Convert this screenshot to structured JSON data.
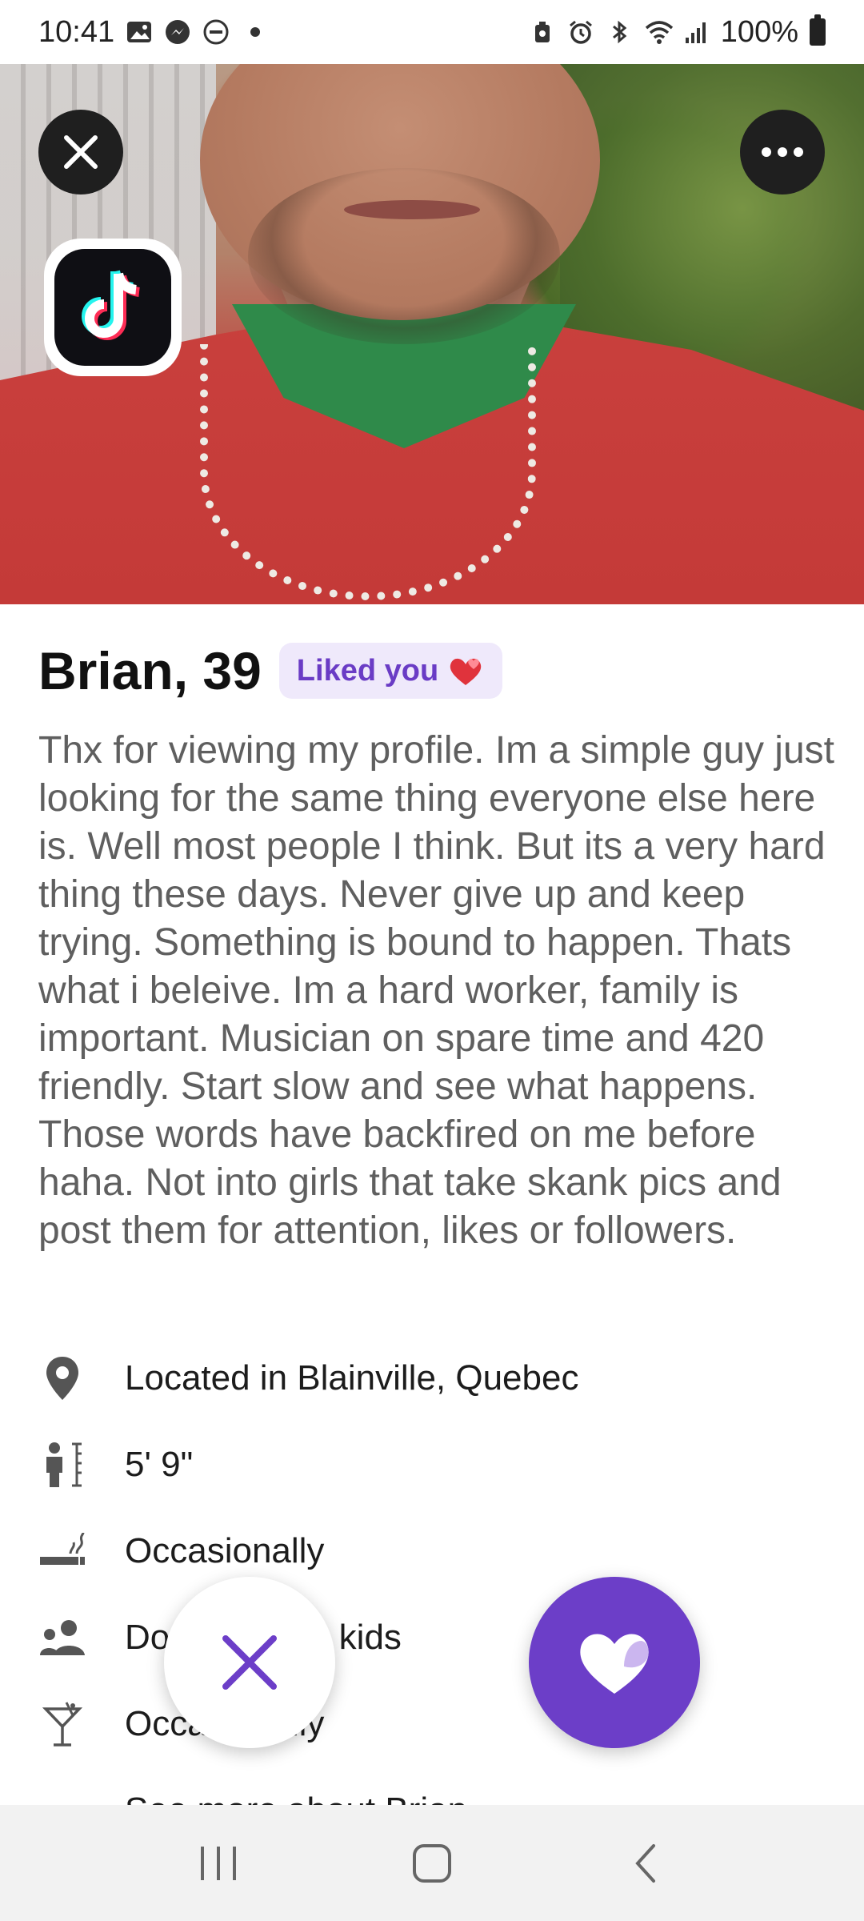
{
  "status_bar": {
    "time": "10:41",
    "battery": "100%"
  },
  "hero": {
    "close_icon": "close-icon",
    "more_icon": "more-horizontal-icon",
    "badge_icon": "tiktok-icon"
  },
  "profile": {
    "name_age": "Brian, 39",
    "liked_badge": "Liked you",
    "bio": "Thx for viewing my profile.  Im a simple guy just looking for the same thing everyone else here is.  Well most people I think.  But its a very hard thing these days.  Never give up and keep trying.  Something is bound to happen.  Thats what i beleive.  Im a hard worker, family is important.  Musician on spare time and 420 friendly.  Start slow and see what happens.  Those words have backfired on me before haha.  Not into girls that take skank pics and post them for attention, likes or followers."
  },
  "details": [
    {
      "icon": "location-pin-icon",
      "text": "Located in Blainville, Quebec"
    },
    {
      "icon": "height-icon",
      "text": "5' 9\""
    },
    {
      "icon": "smoking-icon",
      "text": "Occasionally"
    },
    {
      "icon": "kids-icon",
      "text": "Doesn't have kids"
    },
    {
      "icon": "drinking-icon",
      "text": "Occasionally"
    },
    {
      "icon": "more-dots-icon",
      "text": "See more about Brian"
    }
  ],
  "actions": {
    "pass_icon": "pass-x-icon",
    "like_icon": "heart-icon"
  },
  "colors": {
    "accent": "#6c3ec8",
    "badge_bg": "#efe9fb",
    "bio_text": "#5f5f5f"
  }
}
